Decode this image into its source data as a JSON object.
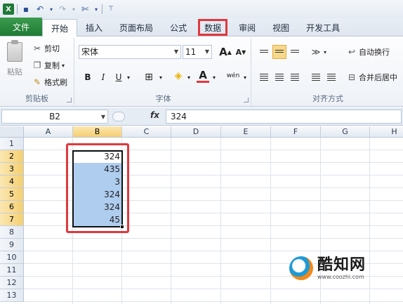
{
  "qat": {
    "icons": [
      "excel-logo-icon",
      "save-icon",
      "undo-icon",
      "redo-icon",
      "customize-icon"
    ]
  },
  "tabs": [
    {
      "label": "文件",
      "id": "file"
    },
    {
      "label": "开始",
      "id": "home"
    },
    {
      "label": "插入",
      "id": "insert"
    },
    {
      "label": "页面布局",
      "id": "page-layout"
    },
    {
      "label": "公式",
      "id": "formulas"
    },
    {
      "label": "数据",
      "id": "data"
    },
    {
      "label": "审阅",
      "id": "review"
    },
    {
      "label": "视图",
      "id": "view"
    },
    {
      "label": "开发工具",
      "id": "developer"
    }
  ],
  "ribbon": {
    "clipboard": {
      "paste": "粘贴",
      "cut": "剪切",
      "copy": "复制",
      "format_painter": "格式刷",
      "label": "剪贴板"
    },
    "font": {
      "name": "宋体",
      "size": "11",
      "label": "字体",
      "bold": "B",
      "italic": "I",
      "underline": "U",
      "grow": "A",
      "shrink": "A",
      "phonetic": "wén"
    },
    "alignment": {
      "wrap_text": "自动换行",
      "merge_center": "合并后居中",
      "label": "对齐方式"
    }
  },
  "formula_bar": {
    "name_box": "B2",
    "fx": "fx",
    "value": "324"
  },
  "grid": {
    "columns": [
      "A",
      "B",
      "C",
      "D",
      "E",
      "F",
      "G",
      "H"
    ],
    "selected_column": "B",
    "rows": [
      "1",
      "2",
      "3",
      "4",
      "5",
      "6",
      "7",
      "8",
      "9",
      "10",
      "11",
      "12",
      "13"
    ],
    "selected_rows": [
      "2",
      "3",
      "4",
      "5",
      "6",
      "7"
    ],
    "column_b_values": [
      "324",
      "435",
      "3",
      "324",
      "324",
      "45"
    ]
  },
  "watermark": {
    "brand": "酷知网",
    "url": "www.coozhi.com"
  },
  "colors": {
    "file_tab": "#1f7a34",
    "highlight_red": "#e0383e",
    "selection_fill": "#aecdef",
    "header_selected": "#f5cf71"
  }
}
